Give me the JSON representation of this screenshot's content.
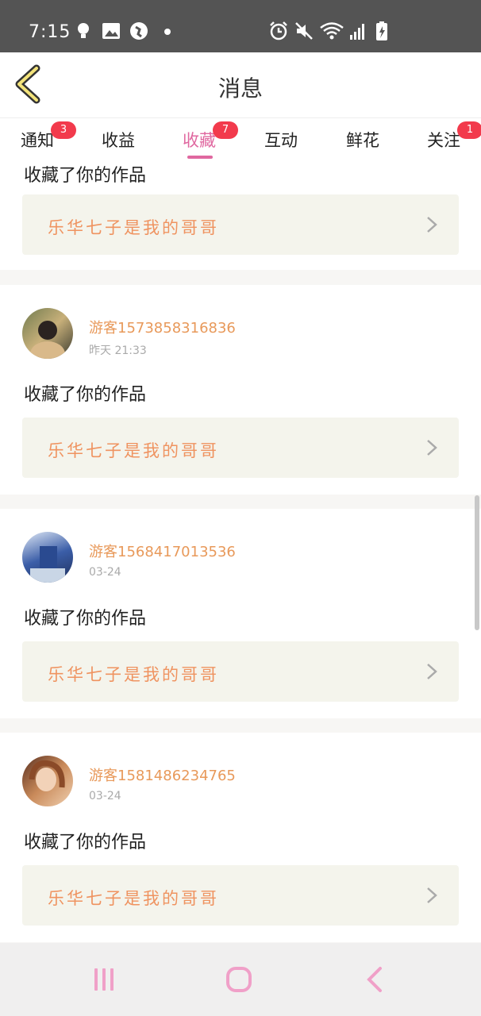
{
  "status": {
    "time": "7:15"
  },
  "header": {
    "title": "消息"
  },
  "tabs": [
    {
      "label": "通知",
      "badge": "3"
    },
    {
      "label": "收益",
      "badge": ""
    },
    {
      "label": "收藏",
      "badge": "7"
    },
    {
      "label": "互动",
      "badge": ""
    },
    {
      "label": "鲜花",
      "badge": ""
    },
    {
      "label": "关注",
      "badge": "1"
    }
  ],
  "items": [
    {
      "action": "收藏了你的作品",
      "work_title": "乐华七子是我的哥哥"
    },
    {
      "username": "游客1573858316836",
      "time": "昨天 21:33",
      "action": "收藏了你的作品",
      "work_title": "乐华七子是我的哥哥"
    },
    {
      "username": "游客1568417013536",
      "time": "03-24",
      "action": "收藏了你的作品",
      "work_title": "乐华七子是我的哥哥"
    },
    {
      "username": "游客1581486234765",
      "time": "03-24",
      "action": "收藏了你的作品",
      "work_title": "乐华七子是我的哥哥"
    }
  ],
  "colors": {
    "accent": "#e068a0",
    "badge": "#f23a4c",
    "username": "#e8995a",
    "work_title": "#ef9360"
  }
}
